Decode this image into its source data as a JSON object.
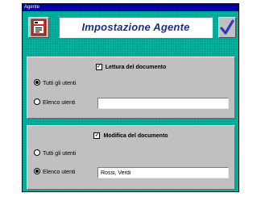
{
  "window": {
    "title": "Agente"
  },
  "header": {
    "title": "Impostazione Agente",
    "logo_icon": "document-settings-icon",
    "ok_icon": "checkmark-icon"
  },
  "read_section": {
    "checkbox_label": "Lettura del documento",
    "checked": true,
    "radio_all_label": "Tutti gli utenti",
    "radio_list_label": "Elenco utenti",
    "selected": "all",
    "users_value": ""
  },
  "edit_section": {
    "checkbox_label": "Modifica del documento",
    "checked": true,
    "radio_all_label": "Tutti gli utenti",
    "radio_list_label": "Elenco utenti",
    "selected": "list",
    "users_value": "Rossi, Verdi"
  },
  "colors": {
    "background": "#00b2a0",
    "panel": "#c0c0c0",
    "title_text": "#1c2d86",
    "check_blue": "#2b3bbf",
    "titlebar": "#0000a8"
  }
}
